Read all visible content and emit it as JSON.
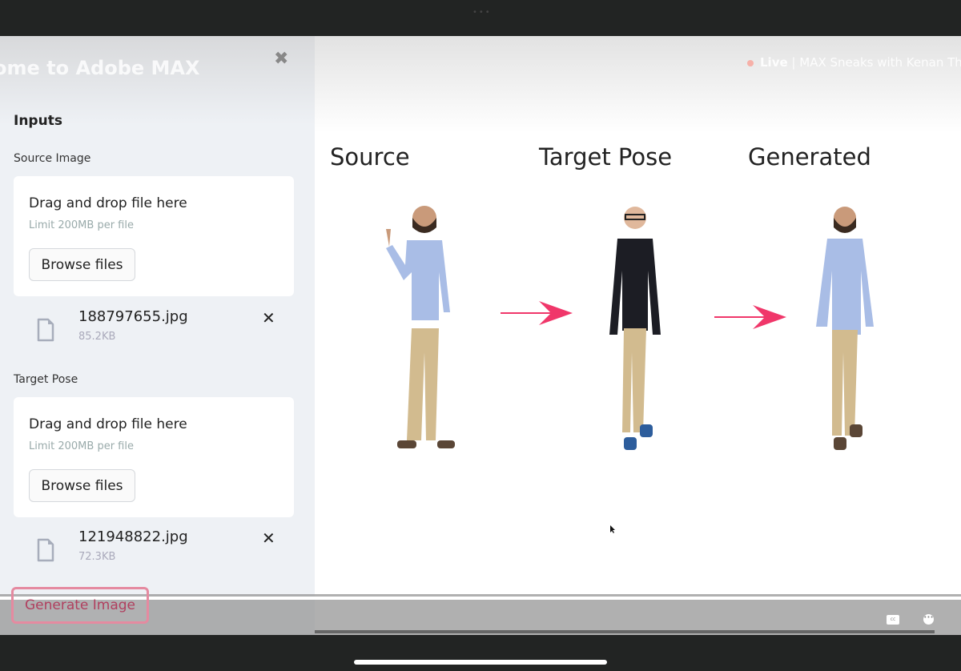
{
  "sidebar": {
    "welcome": "ome to Adobe MAX",
    "close": "✖",
    "inputs_heading": "Inputs",
    "source": {
      "label": "Source Image",
      "drop_title": "Drag and drop file here",
      "drop_limit": "Limit 200MB per file",
      "browse": "Browse files",
      "file_name": "188797655.jpg",
      "file_size": "85.2KB",
      "remove": "✕"
    },
    "target": {
      "label": "Target Pose",
      "drop_title": "Drag and drop file here",
      "drop_limit": "Limit 200MB per file",
      "browse": "Browse files",
      "file_name": "121948822.jpg",
      "file_size": "72.3KB",
      "remove": "✕"
    },
    "generate": "Generate Image"
  },
  "main": {
    "live_label": "Live",
    "live_title": " | MAX Sneaks with Kenan Tho",
    "columns": [
      "Source",
      "Target Pose",
      "Generated"
    ]
  },
  "controls": {
    "cc": "cc",
    "more": "•••"
  },
  "colors": {
    "accent": "#e58aa0",
    "arrow": "#f0376a",
    "shirt": "#a9bde6",
    "pants": "#d2bb8f",
    "cardigan": "#1c1d24"
  }
}
